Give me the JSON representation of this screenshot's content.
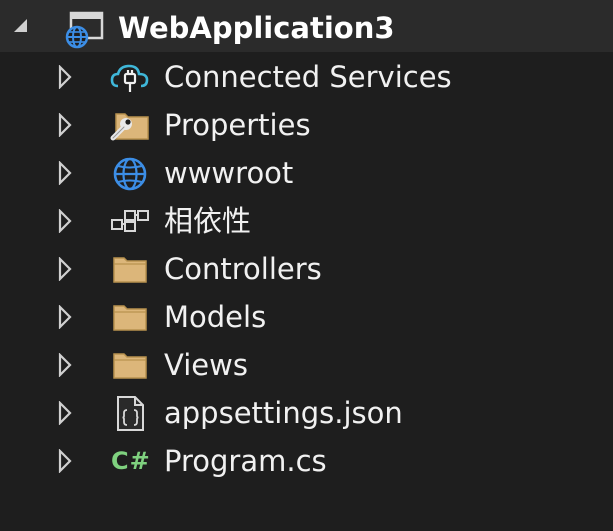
{
  "colors": {
    "background": "#1e1e1e",
    "root_row_background": "#2b2b2b",
    "text": "#f1f1f1",
    "folder_fill": "#dcb67a",
    "globe_blue": "#3c8ee6",
    "csharp_green": "#7fd17f"
  },
  "root": {
    "label": "WebApplication3",
    "expanded": true,
    "icon": "web-project-icon"
  },
  "items": [
    {
      "label": "Connected Services",
      "icon": "connected-services-icon",
      "expanded": false
    },
    {
      "label": "Properties",
      "icon": "properties-folder-icon",
      "expanded": false
    },
    {
      "label": "wwwroot",
      "icon": "globe-icon",
      "expanded": false
    },
    {
      "label": "相依性",
      "icon": "dependencies-icon",
      "expanded": false
    },
    {
      "label": "Controllers",
      "icon": "folder-icon",
      "expanded": false
    },
    {
      "label": "Models",
      "icon": "folder-icon",
      "expanded": false
    },
    {
      "label": "Views",
      "icon": "folder-icon",
      "expanded": false
    },
    {
      "label": "appsettings.json",
      "icon": "json-file-icon",
      "expanded": false
    },
    {
      "label": "Program.cs",
      "icon": "csharp-file-icon",
      "expanded": false,
      "icon_text": "C#"
    }
  ]
}
